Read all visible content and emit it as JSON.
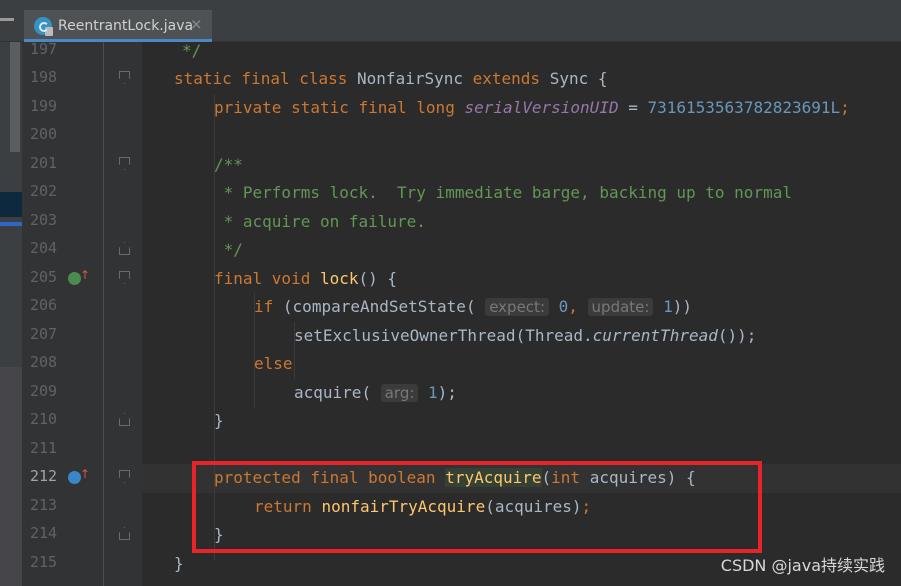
{
  "tab": {
    "filename": "ReentrantLock.java",
    "close": "×"
  },
  "gutter": {
    "lines": [
      "197",
      "198",
      "199",
      "200",
      "201",
      "202",
      "203",
      "204",
      "205",
      "206",
      "207",
      "208",
      "209",
      "210",
      "211",
      "212",
      "213",
      "214",
      "215"
    ]
  },
  "code": {
    "l197": "*/",
    "l198": {
      "kw": "static final class ",
      "name": "NonfairSync ",
      "kw2": "extends ",
      "type": "Sync {"
    },
    "l199": {
      "kw": "private static final long ",
      "field": "serialVersionUID",
      "eq": " = ",
      "num": "7316153563782823691L",
      "semi": ";"
    },
    "l201": "/**",
    "l202": " * Performs lock.  Try immediate barge, backing up to normal",
    "l203": " * acquire on failure.",
    "l204": " */",
    "l205": {
      "kw": "final void ",
      "fn": "lock",
      "rest": "() {"
    },
    "l206": {
      "kw": "if ",
      "open": "(",
      "call": "compareAndSetState",
      "p": "(",
      "h1": "expect:",
      "n1": "0",
      "c": ", ",
      "h2": "update:",
      "n2": "1",
      "close": "))"
    },
    "l207": {
      "call": "setExclusiveOwnerThread",
      "open": "(Thread.",
      "method": "currentThread",
      "close": "());"
    },
    "l208": "else",
    "l209": {
      "call": "acquire",
      "open": "(",
      "hint": "arg:",
      "num": "1",
      "close": ");"
    },
    "l210": "}",
    "l212": {
      "kw": "protected final boolean ",
      "fn": "tryAcquire",
      "open": "(",
      "kw2": "int ",
      "param": "acquires) {"
    },
    "l213": {
      "kw": "return ",
      "call": "nonfairTryAcquire",
      "args": "(acquires)",
      "semi": ";"
    },
    "l214": "}",
    "l215": "}"
  },
  "watermark": "CSDN @java持续实践",
  "colors": {
    "keyword": "#cc7832",
    "comment": "#629755",
    "number": "#6897bb",
    "function": "#ffc66d",
    "highlight": "#e8242b"
  }
}
